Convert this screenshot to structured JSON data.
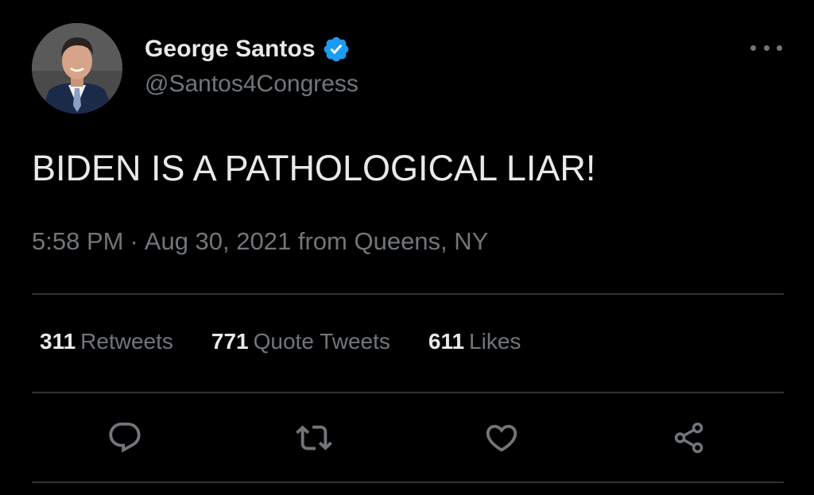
{
  "tweet": {
    "display_name": "George Santos",
    "handle": "@Santos4Congress",
    "text": "BIDEN IS A PATHOLOGICAL LIAR!",
    "time": "5:58 PM",
    "separator": "·",
    "date": "Aug 30, 2021",
    "source": "from Queens, NY",
    "stats": {
      "retweets_count": "311",
      "retweets_label": "Retweets",
      "quotes_count": "771",
      "quotes_label": "Quote Tweets",
      "likes_count": "611",
      "likes_label": "Likes"
    }
  },
  "icons": {
    "more": "more-horizontal-icon",
    "verified": "verified-badge-icon",
    "reply": "reply-icon",
    "retweet": "retweet-icon",
    "like": "heart-icon",
    "share": "share-icon"
  },
  "colors": {
    "background": "#000000",
    "primary_text": "#e7e9ea",
    "secondary_text": "#71767b",
    "verified_blue": "#1d9bf0",
    "divider": "#2f3336"
  }
}
